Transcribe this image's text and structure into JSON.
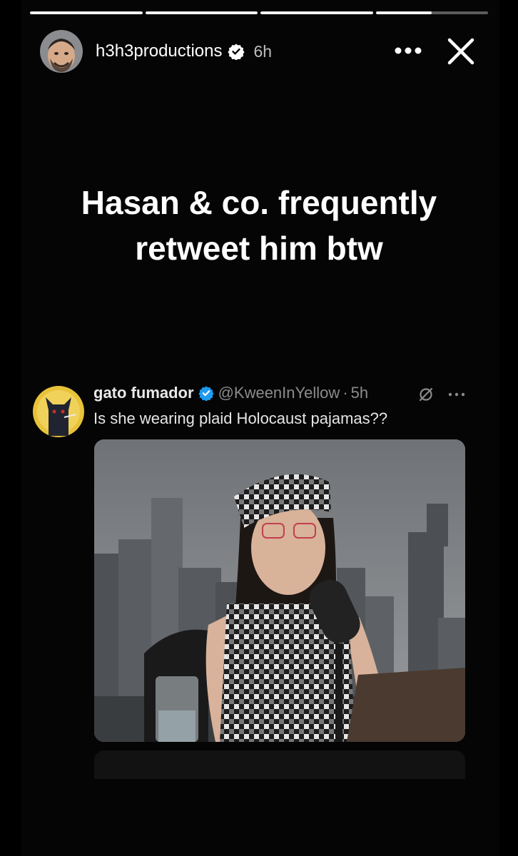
{
  "progress": {
    "segments": 4,
    "active_index": 3,
    "active_fraction": 0.5
  },
  "header": {
    "username": "h3h3productions",
    "time": "6h",
    "icons": {
      "more": "more-dots-icon",
      "close": "close-icon",
      "verified": "verified-badge-icon"
    }
  },
  "caption": {
    "line1": "Hasan & co. frequently",
    "line2": "retweet him btw"
  },
  "tweet": {
    "display_name": "gato fumador",
    "handle": "@KweenInYellow",
    "separator": "·",
    "time": "5h",
    "text": "Is she wearing plaid Holocaust pajamas??",
    "icons": {
      "grok": "grok-icon",
      "more": "more-dots-icon",
      "verified": "verified-badge-icon"
    }
  },
  "colors": {
    "background": "#000000",
    "verified_white": "#ffffff",
    "verified_blue": "#1d9bf0",
    "secondary_text": "#8b8b8b"
  }
}
